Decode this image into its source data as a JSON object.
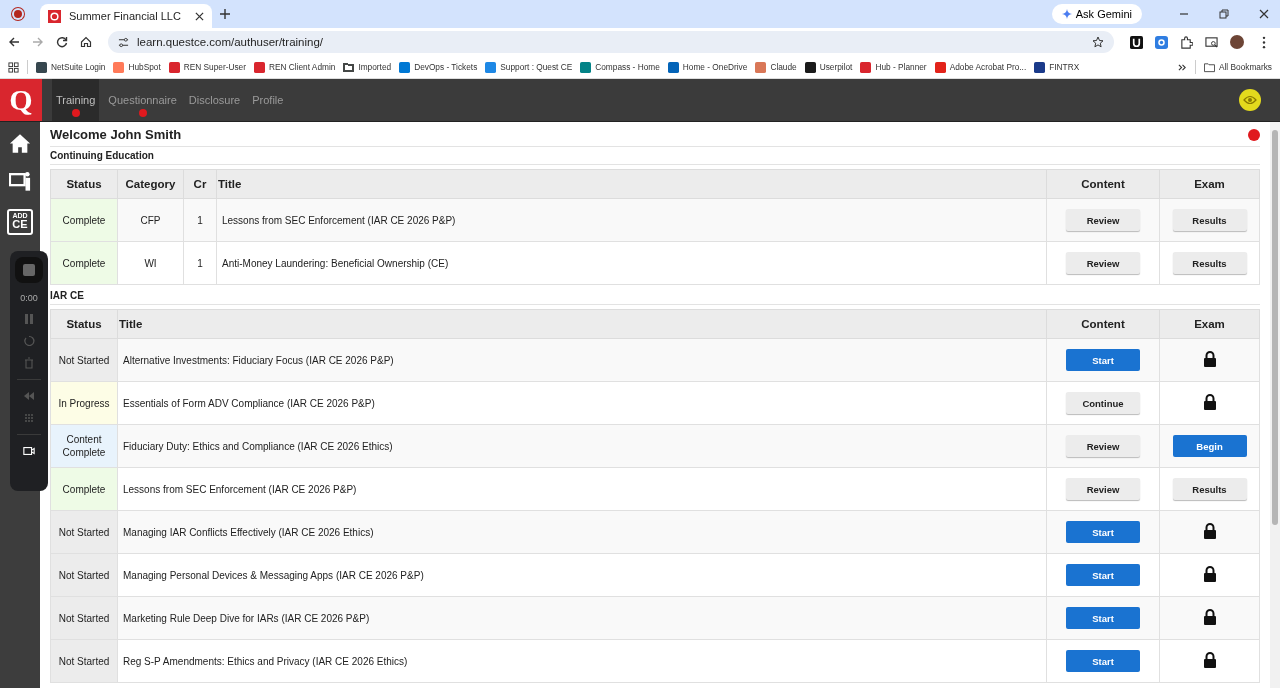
{
  "browser": {
    "tabs": [
      {
        "title": "Summer Financial LLC",
        "selected": true
      }
    ],
    "ask_button": "Ask Gemini",
    "url": "learn.questce.com/authuser/training/",
    "bookmarks": [
      {
        "label": "NetSuite Login",
        "kind": "site",
        "color": "#37474f"
      },
      {
        "label": "HubSpot",
        "kind": "site",
        "color": "#ff7a59"
      },
      {
        "label": "REN Super-User",
        "kind": "site",
        "color": "#d9262e"
      },
      {
        "label": "REN Client Admin",
        "kind": "site",
        "color": "#d9262e"
      },
      {
        "label": "Imported",
        "kind": "folder",
        "color": "#444746"
      },
      {
        "label": "DevOps - Tickets",
        "kind": "site",
        "color": "#0078d4"
      },
      {
        "label": "Support : Quest CE",
        "kind": "site",
        "color": "#1e88e5"
      },
      {
        "label": "Compass - Home",
        "kind": "site",
        "color": "#038387"
      },
      {
        "label": "Home - OneDrive",
        "kind": "site",
        "color": "#0364b8"
      },
      {
        "label": "Claude",
        "kind": "site",
        "color": "#d97757"
      },
      {
        "label": "Userpilot",
        "kind": "site",
        "color": "#1b1b1b"
      },
      {
        "label": "Hub - Planner",
        "kind": "site",
        "color": "#d9262e"
      },
      {
        "label": "Adobe Acrobat Pro...",
        "kind": "site",
        "color": "#e2231a"
      },
      {
        "label": "FINTRX",
        "kind": "site",
        "color": "#1a3a8a"
      }
    ],
    "all_bookmarks": "All Bookmarks"
  },
  "app": {
    "logo": "Q",
    "nav": [
      {
        "label": "Training",
        "selected": true,
        "alert": true
      },
      {
        "label": "Questionnaire",
        "selected": false,
        "alert": true
      },
      {
        "label": "Disclosure",
        "selected": false,
        "alert": false
      },
      {
        "label": "Profile",
        "selected": false,
        "alert": false
      }
    ],
    "badge_top": "ADD",
    "badge_bottom": "CE"
  },
  "recorder": {
    "time": "0:00"
  },
  "welcome": "Welcome John Smith",
  "sections": [
    {
      "title": "Continuing Education",
      "columns": [
        {
          "label": "Status",
          "kind": "status"
        },
        {
          "label": "Category",
          "kind": "category"
        },
        {
          "label": "Cr",
          "kind": "credits"
        },
        {
          "label": "Title",
          "kind": "title"
        },
        {
          "label": "Content",
          "kind": "content"
        },
        {
          "label": "Exam",
          "kind": "exam"
        }
      ],
      "rows": [
        {
          "cells": [
            "Complete",
            "CFP",
            "1",
            "Lessons from SEC Enforcement (IAR CE 2026 P&P)"
          ],
          "color": "#eefbe6",
          "content": {
            "label": "Review",
            "primary": false
          },
          "exam": {
            "kind": "button",
            "label": "Results",
            "primary": false
          }
        },
        {
          "cells": [
            "Complete",
            "WI",
            "1",
            "Anti-Money Laundering: Beneficial Ownership (CE)"
          ],
          "color": "#eefbe6",
          "content": {
            "label": "Review",
            "primary": false
          },
          "exam": {
            "kind": "button",
            "label": "Results",
            "primary": false
          }
        }
      ]
    },
    {
      "title": "IAR CE",
      "columns": [
        {
          "label": "Status",
          "kind": "status"
        },
        {
          "label": "Title",
          "kind": "title"
        },
        {
          "label": "Content",
          "kind": "content"
        },
        {
          "label": "Exam",
          "kind": "exam"
        }
      ],
      "rows": [
        {
          "cells": [
            "Not Started",
            "Alternative Investments: Fiduciary Focus (IAR CE 2026 P&P)"
          ],
          "color": "#ececec",
          "content": {
            "label": "Start",
            "primary": true
          },
          "exam": {
            "kind": "lock"
          }
        },
        {
          "cells": [
            "In Progress",
            "Essentials of Form ADV Compliance (IAR CE 2026 P&P)"
          ],
          "color": "#fdfde6",
          "content": {
            "label": "Continue",
            "primary": false
          },
          "exam": {
            "kind": "lock"
          }
        },
        {
          "cells": [
            "Content Complete",
            "Fiduciary Duty: Ethics and Compliance (IAR CE 2026 Ethics)"
          ],
          "color": "#e8f3fc",
          "content": {
            "label": "Review",
            "primary": false
          },
          "exam": {
            "kind": "button",
            "label": "Begin",
            "primary": true
          }
        },
        {
          "cells": [
            "Complete",
            "Lessons from SEC Enforcement (IAR CE 2026 P&P)"
          ],
          "color": "#eefbe6",
          "content": {
            "label": "Review",
            "primary": false
          },
          "exam": {
            "kind": "button",
            "label": "Results",
            "primary": false
          }
        },
        {
          "cells": [
            "Not Started",
            "Managing IAR Conflicts Effectively (IAR CE 2026 Ethics)"
          ],
          "color": "#ececec",
          "content": {
            "label": "Start",
            "primary": true
          },
          "exam": {
            "kind": "lock"
          }
        },
        {
          "cells": [
            "Not Started",
            "Managing Personal Devices & Messaging Apps (IAR CE 2026 P&P)"
          ],
          "color": "#ececec",
          "content": {
            "label": "Start",
            "primary": true
          },
          "exam": {
            "kind": "lock"
          }
        },
        {
          "cells": [
            "Not Started",
            "Marketing Rule Deep Dive for IARs (IAR CE 2026 P&P)"
          ],
          "color": "#ececec",
          "content": {
            "label": "Start",
            "primary": true
          },
          "exam": {
            "kind": "lock"
          }
        },
        {
          "cells": [
            "Not Started",
            "Reg S-P Amendments: Ethics and Privacy (IAR CE 2026 Ethics)"
          ],
          "color": "#ececec",
          "content": {
            "label": "Start",
            "primary": true
          },
          "exam": {
            "kind": "lock"
          }
        }
      ]
    }
  ]
}
